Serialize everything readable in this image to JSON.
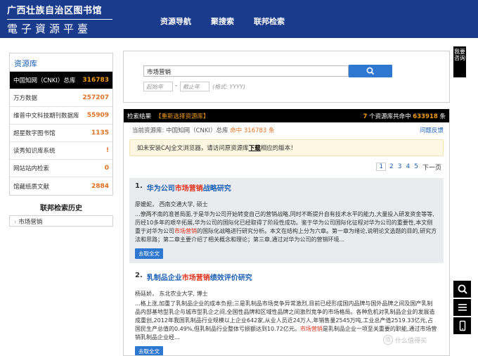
{
  "header": {
    "logo_top": "广西壮族自治区图书馆",
    "logo_bottom": "電子資源平臺",
    "nav": [
      "资源导航",
      "聚搜索",
      "联邦检索"
    ]
  },
  "sidebar": {
    "title": "资源库",
    "items": [
      {
        "label": "中国知网（CNKI）总库",
        "count": "316783"
      },
      {
        "label": "万方数据",
        "count": "257207"
      },
      {
        "label": "维普中文科技期刊数据库",
        "count": "55909"
      },
      {
        "label": "超星数字图书馆",
        "count": "1135"
      },
      {
        "label": "读秀知识库系统",
        "count": "!"
      },
      {
        "label": "网站站内检索",
        "count": "0"
      },
      {
        "label": "馆藏纸质文献",
        "count": "2884"
      }
    ],
    "history_title": "联邦检索历史",
    "history_items": [
      "市场营销"
    ]
  },
  "search": {
    "query": "市场营销",
    "start_placeholder": "起始年",
    "end_placeholder": "截止年",
    "date_sep": "-",
    "format_hint": "(格式: YYYY)"
  },
  "results": {
    "bar_label": "检索结果",
    "reselect": "【重新选择资源库】",
    "lib_count": "7",
    "lib_count_text": "个资源库共命中",
    "total": "633918",
    "total_unit": "条",
    "current_prefix": "当前资源库: 中国知网（CNKI）总库",
    "hits_prefix": "命中",
    "hits": "316783",
    "hits_unit": "条",
    "feedback": "问题反馈",
    "notice_before": "如未安装CAJ全文浏览器，请访问原资源库",
    "notice_link": "下载",
    "notice_after": "相应的版本！",
    "pages": [
      "1",
      "2",
      "3",
      "4",
      "5"
    ],
    "next_label": "下一页",
    "items": [
      {
        "idx": "1.",
        "title_a": "华为公司",
        "title_hl": "市场营销",
        "title_b": "战略研究",
        "meta": "廖媛妮，  西南交通大学, 硕士",
        "abs_a": "...僚两不南的准甚局面,于是华为公司开始转变自己的营销战略,同时不断提升自有技术水平的能力,大量投入研发资金等等,历经10多年的艰辛拓展,华为公司的国际化已经取得了阶段性成功。鉴于华为公司国际化征程对华为公司的重要性,本文侧重于对华为公司",
        "abs_hl": "市场营销",
        "abs_b": "的国际化战略进行研究分析。本文在结构上分为六章。第一章为绪论,说明论文选题的目的,研究方法和思路；第二章主要介绍了相关概念和理论；第三章,通过对华为公司的营销环境...",
        "button": "去取全文"
      },
      {
        "idx": "2.",
        "title_a": "乳制品企业",
        "title_hl": "市场营销",
        "title_b": "绩效评价研究",
        "meta": "杨廷娇，  东北农业大学, 博士",
        "abs_a": "...格上涨,加重了乳制品企业的成本负担;三是乳制品市场竞争异常激烈,目前已经形成国内品牌与国外品牌之间及国产乳制品内部基地型乳企与城市型乳企之间,全国性品牌和区域性品牌之间激烈竞争的市场格局。各种危机对乳制品企业的发展造成重创,2012年我国乳制品行业规模以上企业642家,从业人员近24万人,年销售量2545万吨,工业总产值2519.33亿元,占国民生产总值的0.49%,但乳制品行业整体亏损额达到10.72亿元。",
        "abs_hl": "市场营销",
        "abs_b": "是乳制品企业一项至关重要的职能,通过市场营销乳制品企业经...",
        "button": "去取全文"
      }
    ]
  },
  "right": {
    "help_label": "我要咨询",
    "tools": [
      "search-icon",
      "list-icon",
      "mobile-icon"
    ]
  },
  "watermark": "什么值得买"
}
